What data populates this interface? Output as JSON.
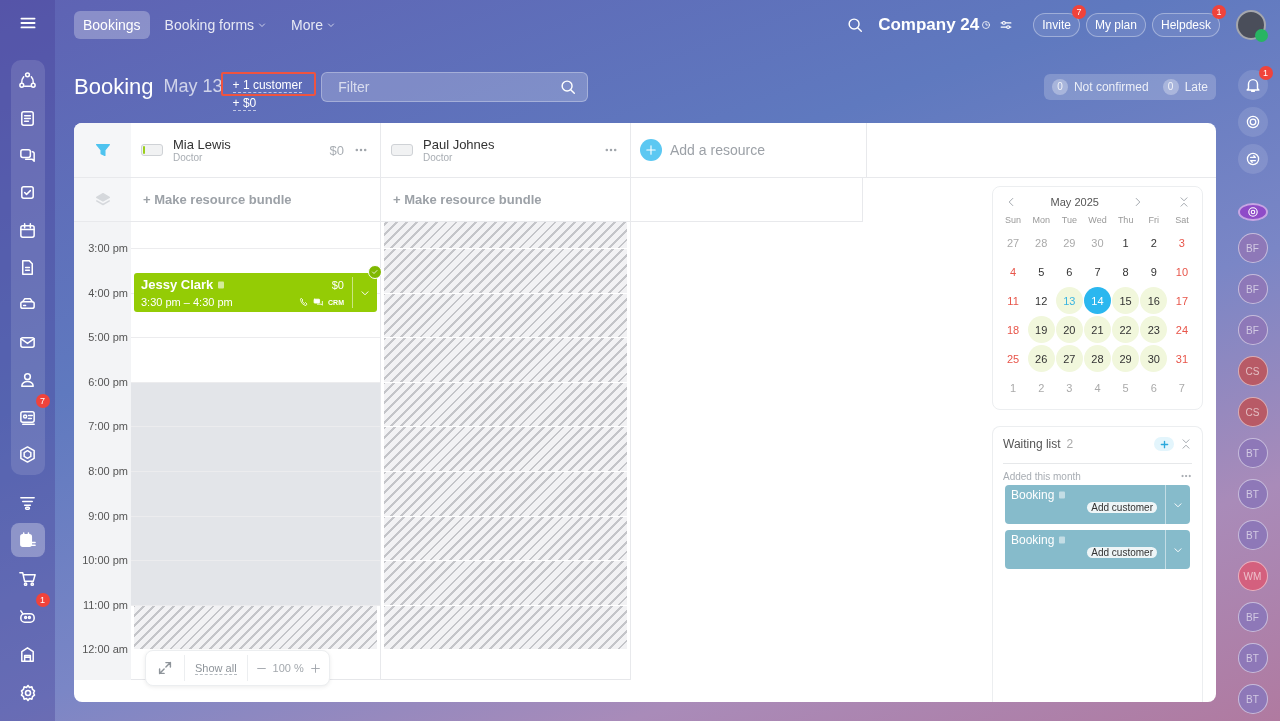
{
  "top_nav": {
    "tabs": [
      {
        "label": "Bookings",
        "selected": true,
        "dropdown": false
      },
      {
        "label": "Booking forms",
        "selected": false,
        "dropdown": true
      },
      {
        "label": "More",
        "selected": false,
        "dropdown": true
      }
    ],
    "company": "Company 24",
    "buttons": [
      {
        "label": "Invite",
        "badge": "7"
      },
      {
        "label": "My plan"
      },
      {
        "label": "Helpdesk",
        "badge": "1"
      }
    ]
  },
  "left_sidebar": {
    "items": [
      {
        "kind": "nodes",
        "selected": false
      },
      {
        "kind": "feed",
        "selected": false
      },
      {
        "kind": "chat",
        "selected": false
      },
      {
        "kind": "tasks",
        "selected": false
      },
      {
        "kind": "calendar",
        "selected": false
      },
      {
        "kind": "document",
        "selected": false
      },
      {
        "kind": "drive",
        "selected": false
      },
      {
        "kind": "mail",
        "selected": false
      },
      {
        "kind": "people",
        "selected": false
      },
      {
        "kind": "card",
        "selected": false,
        "badge": "7"
      },
      {
        "kind": "hexagon",
        "selected": false
      },
      {
        "kind": "funnel",
        "selected": false
      },
      {
        "kind": "booking",
        "selected": true
      },
      {
        "kind": "cart",
        "selected": false
      },
      {
        "kind": "robot",
        "selected": false,
        "badge": "1"
      },
      {
        "kind": "store",
        "selected": false
      }
    ]
  },
  "header": {
    "title": "Booking",
    "date": "May 13",
    "customer_link": "+ 1 customer",
    "sum_link": "+ $0",
    "filter": {
      "placeholder": "Filter"
    },
    "counters": [
      {
        "count": "0",
        "label": "Not confirmed"
      },
      {
        "count": "0",
        "label": "Late"
      }
    ]
  },
  "schedule": {
    "resources": [
      {
        "name": "Mia Lewis",
        "role": "Doctor",
        "amount": "$0",
        "level": 0.12,
        "bundle": "+ Make resource bundle",
        "slots": [
          {
            "closed": false,
            "hatched": false
          },
          {
            "closed": false,
            "hatched": false
          },
          {
            "closed": false,
            "hatched": false
          },
          {
            "closed": false,
            "hatched": false
          },
          {
            "closed": true,
            "hatched": false
          },
          {
            "closed": true,
            "hatched": false
          },
          {
            "closed": true,
            "hatched": false
          },
          {
            "closed": true,
            "hatched": false
          },
          {
            "closed": true,
            "hatched": false
          },
          {
            "closed": true,
            "hatched": true
          }
        ],
        "bookings": [
          {
            "name": "Jessy Clark",
            "time": "3:30 pm – 4:30 pm",
            "price": "$0",
            "tag": "CRM",
            "confirmed": true
          }
        ]
      },
      {
        "name": "Paul Johnes",
        "role": "Doctor",
        "bundle": "+ Make resource bundle",
        "slots": [
          {
            "closed": true,
            "hatched": true
          },
          {
            "closed": true,
            "hatched": true
          },
          {
            "closed": true,
            "hatched": true
          },
          {
            "closed": true,
            "hatched": true
          },
          {
            "closed": true,
            "hatched": true
          },
          {
            "closed": true,
            "hatched": true
          },
          {
            "closed": true,
            "hatched": true
          },
          {
            "closed": true,
            "hatched": true
          },
          {
            "closed": true,
            "hatched": true
          },
          {
            "closed": true,
            "hatched": true
          }
        ]
      }
    ],
    "add_resource": "Add a resource",
    "times": [
      "3:00 pm",
      "4:00 pm",
      "5:00 pm",
      "6:00 pm",
      "7:00 pm",
      "8:00 pm",
      "9:00 pm",
      "10:00 pm",
      "11:00 pm",
      "12:00 am"
    ],
    "zoom": {
      "show_all": "Show all",
      "value": "100 %"
    }
  },
  "calendar": {
    "month": "May 2025",
    "weekdays": [
      "Sun",
      "Mon",
      "Tue",
      "Wed",
      "Thu",
      "Fri",
      "Sat"
    ],
    "weeks": [
      [
        {
          "label": "27",
          "kind": "muted",
          "selected": false,
          "free": false
        },
        {
          "label": "28",
          "kind": "muted",
          "selected": false,
          "free": false
        },
        {
          "label": "29",
          "kind": "muted",
          "selected": false,
          "free": false
        },
        {
          "label": "30",
          "kind": "muted",
          "selected": false,
          "free": false
        },
        {
          "label": "1",
          "kind": "day",
          "selected": false,
          "free": false
        },
        {
          "label": "2",
          "kind": "day",
          "selected": false,
          "free": false
        },
        {
          "label": "3",
          "kind": "weekend",
          "selected": false,
          "free": false
        }
      ],
      [
        {
          "label": "4",
          "kind": "weekend",
          "selected": false,
          "free": false
        },
        {
          "label": "5",
          "kind": "day",
          "selected": false,
          "free": false
        },
        {
          "label": "6",
          "kind": "day",
          "selected": false,
          "free": false
        },
        {
          "label": "7",
          "kind": "day",
          "selected": false,
          "free": false
        },
        {
          "label": "8",
          "kind": "day",
          "selected": false,
          "free": false
        },
        {
          "label": "9",
          "kind": "day",
          "selected": false,
          "free": false
        },
        {
          "label": "10",
          "kind": "weekend",
          "selected": false,
          "free": false
        }
      ],
      [
        {
          "label": "11",
          "kind": "weekend",
          "selected": false,
          "free": false
        },
        {
          "label": "12",
          "kind": "day",
          "selected": false,
          "free": false
        },
        {
          "label": "13",
          "kind": "today",
          "selected": false,
          "free": true
        },
        {
          "label": "14",
          "kind": "day",
          "selected": true,
          "free": false
        },
        {
          "label": "15",
          "kind": "day",
          "selected": false,
          "free": true
        },
        {
          "label": "16",
          "kind": "day",
          "selected": false,
          "free": true
        },
        {
          "label": "17",
          "kind": "weekend",
          "selected": false,
          "free": false
        }
      ],
      [
        {
          "label": "18",
          "kind": "weekend",
          "selected": false,
          "free": false
        },
        {
          "label": "19",
          "kind": "day",
          "selected": false,
          "free": true
        },
        {
          "label": "20",
          "kind": "day",
          "selected": false,
          "free": true
        },
        {
          "label": "21",
          "kind": "day",
          "selected": false,
          "free": true
        },
        {
          "label": "22",
          "kind": "day",
          "selected": false,
          "free": true
        },
        {
          "label": "23",
          "kind": "day",
          "selected": false,
          "free": true
        },
        {
          "label": "24",
          "kind": "weekend",
          "selected": false,
          "free": false
        }
      ],
      [
        {
          "label": "25",
          "kind": "weekend",
          "selected": false,
          "free": false
        },
        {
          "label": "26",
          "kind": "day",
          "selected": false,
          "free": true
        },
        {
          "label": "27",
          "kind": "day",
          "selected": false,
          "free": true
        },
        {
          "label": "28",
          "kind": "day",
          "selected": false,
          "free": true
        },
        {
          "label": "29",
          "kind": "day",
          "selected": false,
          "free": true
        },
        {
          "label": "30",
          "kind": "day",
          "selected": false,
          "free": true
        },
        {
          "label": "31",
          "kind": "weekend",
          "selected": false,
          "free": false
        }
      ],
      [
        {
          "label": "1",
          "kind": "muted",
          "selected": false,
          "free": false
        },
        {
          "label": "2",
          "kind": "muted",
          "selected": false,
          "free": false
        },
        {
          "label": "3",
          "kind": "muted",
          "selected": false,
          "free": false
        },
        {
          "label": "4",
          "kind": "muted",
          "selected": false,
          "free": false
        },
        {
          "label": "5",
          "kind": "muted",
          "selected": false,
          "free": false
        },
        {
          "label": "6",
          "kind": "muted",
          "selected": false,
          "free": false
        },
        {
          "label": "7",
          "kind": "muted",
          "selected": false,
          "free": false
        }
      ]
    ]
  },
  "waiting_list": {
    "title": "Waiting list",
    "count": "2",
    "section": "Added this month",
    "items": [
      {
        "title": "Booking",
        "action": "Add customer"
      },
      {
        "title": "Booking",
        "action": "Add customer"
      }
    ]
  },
  "right_bar": {
    "bell_badge": "1",
    "avatars": [
      {
        "initials": "BF",
        "color": "#8e78b8"
      },
      {
        "initials": "BF",
        "color": "#8e78b8"
      },
      {
        "initials": "BF",
        "color": "#8e78b8"
      },
      {
        "initials": "CS",
        "color": "#b85a66"
      },
      {
        "initials": "CS",
        "color": "#b85a66"
      },
      {
        "initials": "BT",
        "color": "#8e78b8"
      },
      {
        "initials": "BT",
        "color": "#8e78b8"
      },
      {
        "initials": "BT",
        "color": "#8e78b8"
      },
      {
        "initials": "WM",
        "color": "#d4607e"
      },
      {
        "initials": "BF",
        "color": "#8e78b8"
      },
      {
        "initials": "BT",
        "color": "#8e78b8"
      },
      {
        "initials": "BT",
        "color": "#8e78b8"
      }
    ]
  }
}
